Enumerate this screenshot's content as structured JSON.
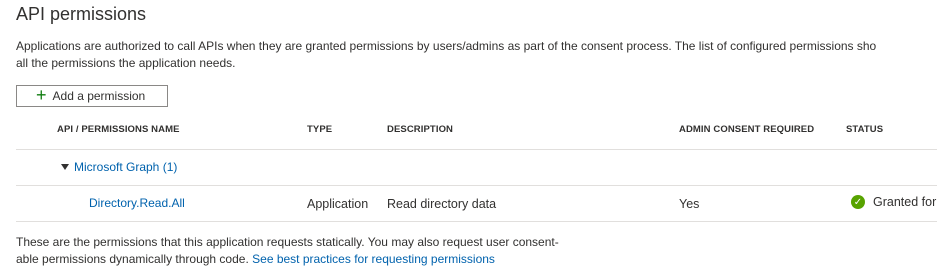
{
  "page": {
    "title": "API permissions",
    "intro_line1": "Applications are authorized to call APIs when they are granted permissions by users/admins as part of the consent process. The list of configured permissions sho",
    "intro_line2": "all the permissions the application needs."
  },
  "toolbar": {
    "add_label": "Add a permission",
    "add_icon": "plus-icon"
  },
  "table": {
    "headers": {
      "name": "API / PERMISSIONS NAME",
      "type": "TYPE",
      "description": "DESCRIPTION",
      "admin_consent": "ADMIN CONSENT REQUIRED",
      "status": "STATUS"
    },
    "group": {
      "label": "Microsoft Graph (1)",
      "icon": "caret-down-icon"
    },
    "rows": [
      {
        "name": "Directory.Read.All",
        "type": "Application",
        "description": "Read directory data",
        "admin_consent": "Yes",
        "status": "Granted for",
        "status_icon": "check-circle-icon",
        "status_color": "#57a300"
      }
    ]
  },
  "footer": {
    "line1": "These are the permissions that this application requests statically. You may also request user consent-",
    "line2": "able permissions dynamically through code.",
    "link": "See best practices for requesting permissions"
  },
  "colors": {
    "link": "#0062ad",
    "accent_green": "#107c10",
    "divider": "#e1dfdd"
  }
}
